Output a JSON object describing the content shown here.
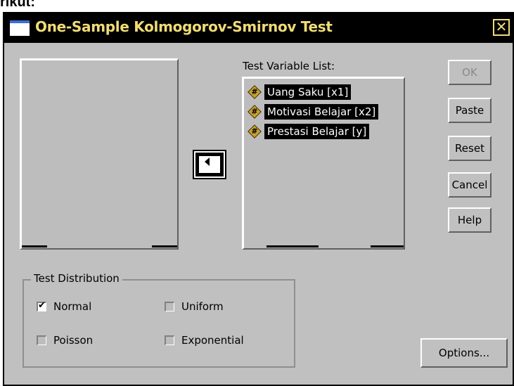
{
  "page_text": "rikut:",
  "window": {
    "title": "One-Sample Kolmogorov-Smirnov Test",
    "close_symbol": "✕"
  },
  "test_variable_list": {
    "label": "Test Variable List:",
    "items": [
      {
        "icon": "scale-variable-icon",
        "label": "Uang Saku [x1]"
      },
      {
        "icon": "scale-variable-icon",
        "label": "Motivasi Belajar [x2]"
      },
      {
        "icon": "scale-variable-icon",
        "label": "Prestasi Belajar [y]"
      }
    ]
  },
  "buttons": {
    "ok": "OK",
    "paste": "Paste",
    "reset": "Reset",
    "cancel": "Cancel",
    "help": "Help",
    "options": "Options..."
  },
  "test_distribution": {
    "title": "Test Distribution",
    "normal": {
      "label": "Normal",
      "checked": true
    },
    "uniform": {
      "label": "Uniform",
      "checked": false
    },
    "poisson": {
      "label": "Poisson",
      "checked": false
    },
    "exponential": {
      "label": "Exponential",
      "checked": false
    }
  },
  "colors": {
    "dialog_bg": "#c0c0c0",
    "titlebar_bg": "#000000",
    "title_text": "#f0dc76",
    "selection_bg": "#000000"
  }
}
